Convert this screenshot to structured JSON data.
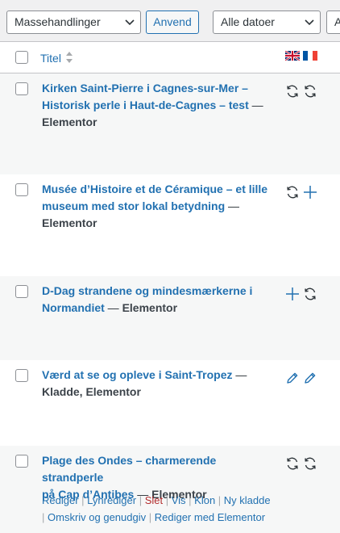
{
  "toolbar": {
    "bulk_actions": "Massehandlinger",
    "apply_label": "Anvend",
    "date_filter": "Alle datoer",
    "next_filter": "A"
  },
  "table": {
    "title_header": "Titel",
    "language_flags": [
      "gb-flag-icon",
      "fr-flag-icon"
    ],
    "rows": [
      {
        "title_line1": "Kirken Saint-Pierre i Cagnes-sur-Mer –",
        "title_line2": "Historisk perle i Haut-de-Cagnes – test",
        "separator": " —",
        "state": "Elementor",
        "translation_icons": [
          "sync-icon",
          "sync-icon"
        ]
      },
      {
        "title_line1": "Musée d’Histoire et de Céramique – et lille",
        "title_line2": "museum med stor lokal betydning",
        "separator": " —",
        "state": "Elementor",
        "translation_icons": [
          "sync-icon",
          "plus-icon"
        ]
      },
      {
        "title_line1": "D-Dag strandene og mindesmærkerne i",
        "title_line2": "Normandiet",
        "separator": " —",
        "state": "Elementor",
        "translation_icons": [
          "plus-icon",
          "sync-icon"
        ]
      },
      {
        "title_line1": "Værd at se og opleve i Saint-Tropez",
        "separator": " —",
        "state": "Kladde, Elementor",
        "translation_icons": [
          "pencil-icon",
          "pencil-icon"
        ]
      },
      {
        "title_line1": "Plage des Ondes – charmerende strandperle",
        "title_line2": "på Cap d’Antibes",
        "separator": " —",
        "state": "Elementor",
        "translation_icons": [
          "sync-icon",
          "sync-icon"
        ],
        "actions": {
          "edit": "Rediger",
          "quick_edit": "Lynrediger",
          "trash": "Slet",
          "view": "Vis",
          "clone": "Klon",
          "new_draft": "Ny kladde",
          "rewrite": "Omskriv og genudgiv",
          "edit_elementor": "Rediger med Elementor",
          "divider": " | "
        }
      }
    ]
  },
  "colors": {
    "link": "#2271b1",
    "delete": "#b32d2e",
    "row_alt": "#f6f7f7",
    "border": "#c3c4c7"
  }
}
